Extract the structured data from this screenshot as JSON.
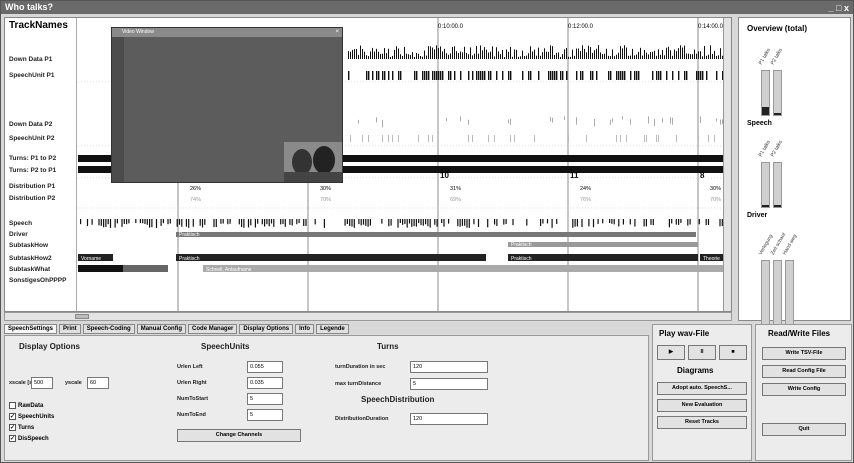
{
  "window": {
    "title": "Who talks?",
    "controls": "_ □ x"
  },
  "tracks": {
    "header": "TrackNames",
    "names": [
      "Down Data P1",
      "SpeechUnit P1",
      "Down Data P2",
      "SpeechUnit P2",
      "Turns: P1 to P2",
      "Turns: P2 to P1",
      "Distribution P1",
      "Distribution P2",
      "Speech",
      "Driver",
      "SubtaskHow",
      "SubtaskHow2",
      "SubtaskWhat",
      "SonstigesOhPPPP"
    ],
    "time_labels": [
      "0:10:00.0",
      "0:12:00.0",
      "0:14:00.0"
    ],
    "turn_numbers": [
      "10",
      "11",
      "8"
    ],
    "distribution_p1": [
      "26%",
      "30%",
      "31%",
      "24%",
      "30%"
    ],
    "distribution_p2": [
      "74%",
      "70%",
      "69%",
      "76%",
      "70%"
    ],
    "segment_labels": [
      "Praktisch",
      "Praktisch",
      "Vorname",
      "Schnell, Anlaufname",
      "Praktisch",
      "Praktisch",
      "Theorie"
    ]
  },
  "video": {
    "title": "Video Window"
  },
  "overview": {
    "title": "Overview (total)",
    "groups": [
      {
        "label": "Speech",
        "fill": 0.18,
        "bar_labels": [
          "P1 talks",
          "P2 talks"
        ]
      },
      {
        "label": "Driver",
        "fill": 0.05,
        "bar_labels": [
          "P1 talks",
          "P2 talks"
        ]
      },
      {
        "label": "",
        "fill": 0,
        "bar_labels": [
          "Verlegung",
          "Zeit schaut",
          "Hand weg"
        ]
      }
    ]
  },
  "tabs": [
    "SpeechSettings",
    "Print",
    "Speech-Coding",
    "Manual Config",
    "Code Manager",
    "Display Options",
    "Info",
    "Legende"
  ],
  "display_options": {
    "title": "Display Options",
    "xscale_label": "xscale [s]",
    "xscale_value": "500",
    "yscale_label": "yscale",
    "yscale_value": "60",
    "checks": [
      {
        "label": "RawData",
        "checked": false
      },
      {
        "label": "SpeechUnits",
        "checked": true
      },
      {
        "label": "Turns",
        "checked": true
      },
      {
        "label": "DisSpeech",
        "checked": true
      }
    ]
  },
  "speech_units": {
    "title": "SpeechUnits",
    "fields": [
      {
        "label": "Urlen Left",
        "value": "0.055"
      },
      {
        "label": "Urlen Right",
        "value": "0.035"
      },
      {
        "label": "NumToStart",
        "value": "5"
      },
      {
        "label": "NumToEnd",
        "value": "5"
      }
    ],
    "change_channels": "Change Channels"
  },
  "turns": {
    "title": "Turns",
    "fields": [
      {
        "label": "turnDuration in sec",
        "value": "120"
      },
      {
        "label": "max turnDistance",
        "value": "5"
      }
    ]
  },
  "speech_distribution": {
    "title": "SpeechDistribution",
    "fields": [
      {
        "label": "DistributionDuration",
        "value": "120"
      }
    ]
  },
  "play": {
    "title": "Play wav-File",
    "buttons": [
      "▶",
      "II",
      "■"
    ],
    "diagrams_title": "Diagrams",
    "actions": [
      "Adopt auto. SpeechS...",
      "New Evaluation",
      "Reset Tracks"
    ]
  },
  "files": {
    "title": "Read/Write Files",
    "buttons": [
      "Write TSV-File",
      "Read Config File",
      "Write Config",
      "Quit"
    ]
  }
}
